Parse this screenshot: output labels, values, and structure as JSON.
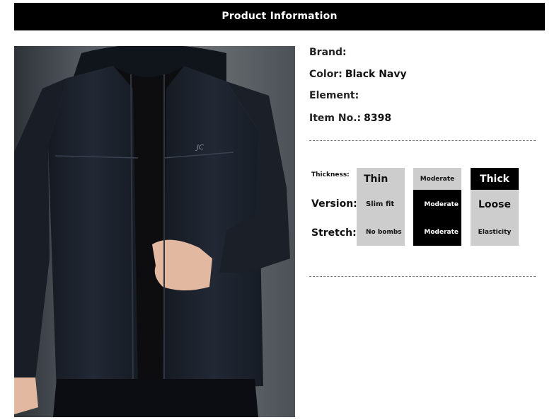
{
  "header": {
    "title": "Product Information"
  },
  "product": {
    "photo_alt": "Man wearing dark navy hooded zip jacket"
  },
  "info": {
    "brand_label": "Brand:",
    "brand_value": "",
    "color_label": "Color:",
    "color_value": "Black Navy",
    "element_label": "Element:",
    "element_value": "",
    "item_label": "Item No.:",
    "item_value": "8398"
  },
  "attributes": {
    "thickness_label": "Thickness:",
    "version_label": "Version:",
    "stretch_label": "Stretch:",
    "columns": [
      {
        "thickness": "Thin",
        "version": "Slim fit",
        "stretch": "No bombs"
      },
      {
        "thickness": "Moderate",
        "version": "Moderate",
        "stretch": "Moderate"
      },
      {
        "thickness": "Thick",
        "version": "Loose",
        "stretch": "Elasticity"
      }
    ],
    "selected": {
      "thickness": "Thick",
      "version": "Moderate",
      "stretch": "Moderate"
    }
  },
  "colors": {
    "header_bg": "#000000",
    "unselected_bg": "#cdcdcd",
    "selected_bg": "#000000"
  }
}
